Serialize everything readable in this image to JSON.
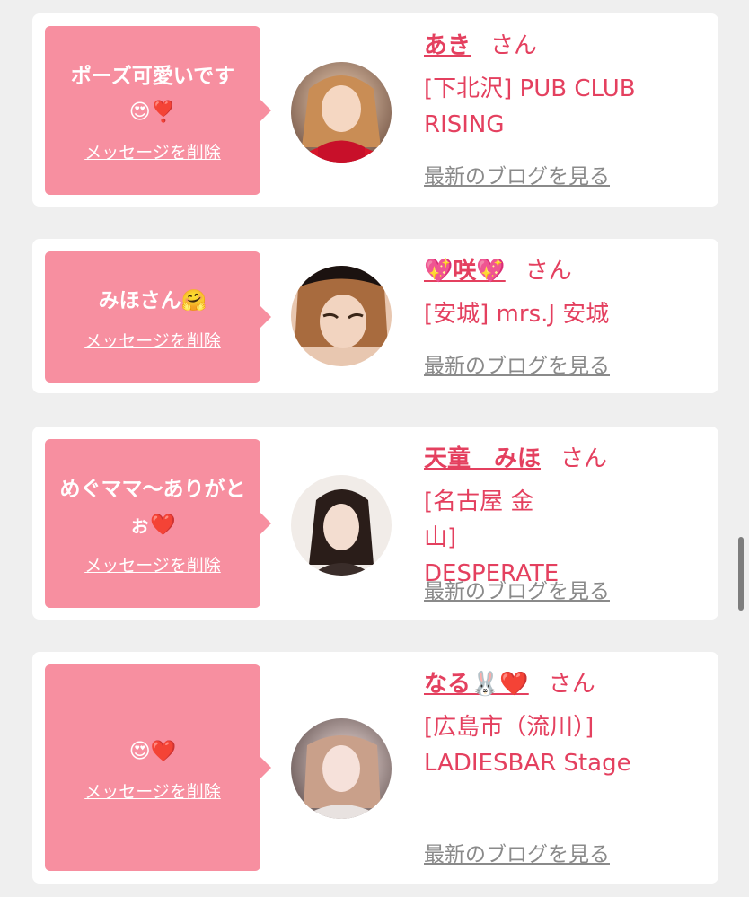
{
  "delete_label": "メッセージを削除",
  "blog_label": "最新のブログを見る",
  "honorific": "さん",
  "colors": {
    "bubble": "#f78fa0",
    "name": "#e4405f",
    "link_gray": "#8a8a8a",
    "background": "#efefef"
  },
  "messages": [
    {
      "text": "ポーズ可愛いです😍❣️",
      "name": "あき",
      "shop": "[下北沢] PUB CLUB RISING"
    },
    {
      "text": "みほさん🤗",
      "name": "💖咲💖",
      "shop": "[安城] mrs.J 安城"
    },
    {
      "text": "めぐママ〜ありがとぉ❤️",
      "name": "天童　みほ",
      "shop": "[名古屋 金山] DESPERATE"
    },
    {
      "text": "😍❤️",
      "name": "なる🐰❤️",
      "shop": "[広島市（流川）] LADIESBAR Stage"
    }
  ]
}
